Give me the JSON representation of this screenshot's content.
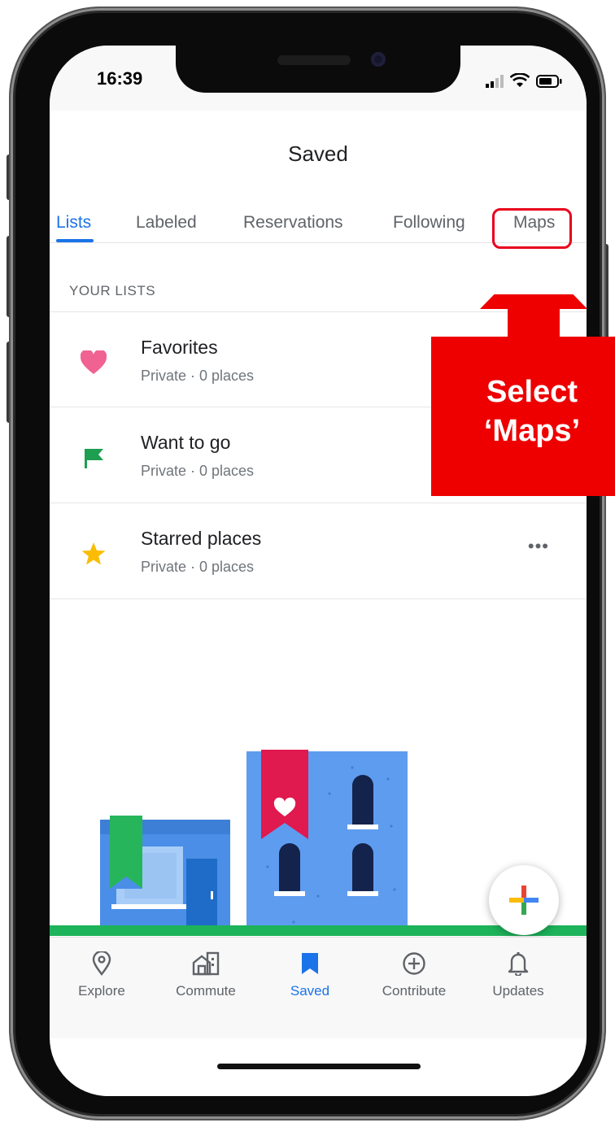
{
  "status": {
    "time": "16:39"
  },
  "header": {
    "title": "Saved"
  },
  "tabs": [
    {
      "label": "Lists",
      "active": true
    },
    {
      "label": "Labeled"
    },
    {
      "label": "Reservations"
    },
    {
      "label": "Following"
    },
    {
      "label": "Maps"
    }
  ],
  "section_label": "YOUR LISTS",
  "lists": [
    {
      "title": "Favorites",
      "subtitle": "Private · 0 places",
      "icon": "heart-icon",
      "color": "#f06292"
    },
    {
      "title": "Want to go",
      "subtitle": "Private · 0 places",
      "icon": "flag-icon",
      "color": "#1e9e50"
    },
    {
      "title": "Starred places",
      "subtitle": "Private · 0 places",
      "icon": "star-icon",
      "color": "#fbbc04"
    }
  ],
  "more_label": "•••",
  "bottom_nav": [
    {
      "label": "Explore",
      "icon": "location-pin-icon"
    },
    {
      "label": "Commute",
      "icon": "commute-icon"
    },
    {
      "label": "Saved",
      "icon": "bookmark-icon",
      "active": true
    },
    {
      "label": "Contribute",
      "icon": "plus-circle-icon"
    },
    {
      "label": "Updates",
      "icon": "bell-icon"
    }
  ],
  "annotation": {
    "line1": "Select",
    "line2": "‘Maps’"
  },
  "colors": {
    "accent": "#1a73e8",
    "annotation_red": "#e8001c",
    "grass": "#1db35a"
  }
}
